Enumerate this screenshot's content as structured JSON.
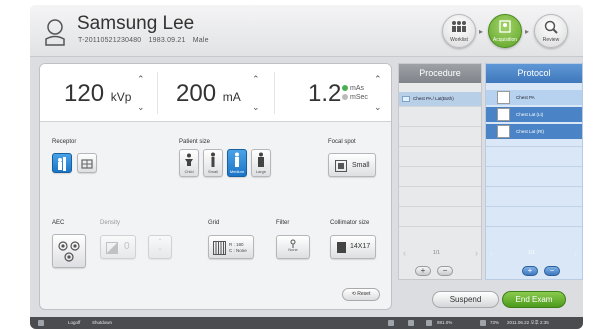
{
  "patient": {
    "name": "Samsung Lee",
    "id": "T-20110521230480",
    "birth_date": "1983.09.21",
    "sex": "Male"
  },
  "workflow": {
    "steps": [
      {
        "label": "Worklist",
        "icon": "worklist-icon",
        "active": false
      },
      {
        "label": "Acquisition",
        "icon": "acquisition-icon",
        "active": true
      },
      {
        "label": "Review",
        "icon": "review-icon",
        "active": false
      }
    ],
    "arrow": "▸",
    "active_color": "#6ab32e"
  },
  "exposure": {
    "kvp_value": "120",
    "kvp_unit": "kVp",
    "ma_value": "200",
    "ma_unit": "mA",
    "time_value": "1.2",
    "time_mode_mas": "mAs",
    "time_mode_msec": "mSec",
    "up": "⌃",
    "down": "⌄"
  },
  "receptor": {
    "label": "Receptor"
  },
  "patient_size": {
    "label": "Patient size",
    "options": [
      {
        "label": "Child",
        "selected": false
      },
      {
        "label": "Small",
        "selected": false
      },
      {
        "label": "Medium",
        "selected": true
      },
      {
        "label": "Large",
        "selected": false
      }
    ]
  },
  "focal_spot": {
    "label": "Focal spot",
    "value": "Small"
  },
  "aec": {
    "label": "AEC"
  },
  "density": {
    "label": "Density",
    "value": "0"
  },
  "grid": {
    "label": "Grid",
    "r_value": "R : 180",
    "c_value": "C : None"
  },
  "filter": {
    "label": "Filter",
    "value": "None"
  },
  "collimator": {
    "label": "Collimator size",
    "value": "14X17"
  },
  "reset_label": "Reset",
  "procedure": {
    "header": "Procedure",
    "items": [
      "Chest PA / Lat(Both)"
    ],
    "pager": "1/1"
  },
  "protocol": {
    "header": "Protocol",
    "items": [
      "Chest PA",
      "Chest Lat (Lt)",
      "Chest Lat (Rt)"
    ],
    "pager": "1/1"
  },
  "actions": {
    "suspend": "Suspend",
    "end_exam": "End Exam"
  },
  "statusbar": {
    "logoff": "Logoff",
    "shutdown": "Shutdown",
    "battery": "981.0%",
    "storage": "73%",
    "datetime": "2011.06.22 오후 2:35"
  },
  "colors": {
    "accent_blue": "#2b84d6",
    "accent_green": "#5ea428",
    "protocol_blue": "#4a84c6"
  }
}
